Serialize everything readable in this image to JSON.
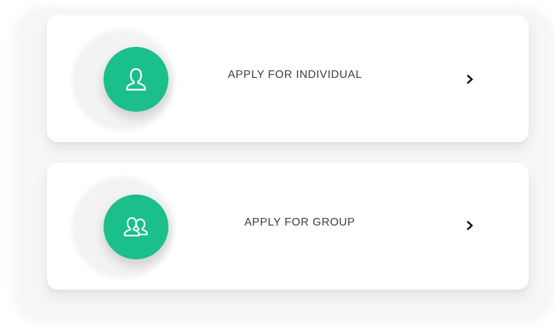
{
  "options": [
    {
      "label": "APPLY FOR INDIVIDUAL",
      "icon": "user-icon",
      "arrow_icon": "chevron-right-icon"
    },
    {
      "label": "APPLY FOR GROUP",
      "icon": "users-icon",
      "arrow_icon": "chevron-right-icon"
    }
  ],
  "colors": {
    "accent": "#1abf8c",
    "card": "#ffffff",
    "text": "#3c3c3c",
    "chevron": "#111111"
  }
}
